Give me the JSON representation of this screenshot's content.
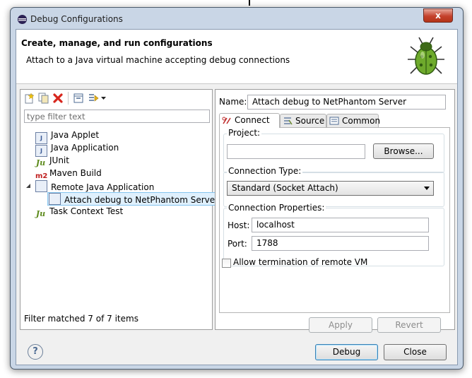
{
  "window": {
    "title": "Debug Configurations",
    "close_glyph": "x"
  },
  "banner": {
    "title": "Create, manage, and run configurations",
    "subtitle": "Attach to a Java virtual machine accepting debug connections",
    "icon": "bug-icon"
  },
  "left": {
    "toolbar": [
      "new-config-icon",
      "duplicate-icon",
      "delete-icon",
      "collapse-all-icon",
      "filter-icon",
      "dropdown-arrow-icon"
    ],
    "filter_placeholder": "type filter text",
    "tree": [
      {
        "label": "Java Applet",
        "icon": "java-applet-icon"
      },
      {
        "label": "Java Application",
        "icon": "java-app-icon"
      },
      {
        "label": "JUnit",
        "icon": "junit-icon"
      },
      {
        "label": "Maven Build",
        "icon": "maven-icon"
      },
      {
        "label": "Remote Java Application",
        "icon": "remote-java-icon"
      },
      {
        "label": "Attach debug to NetPhantom Server",
        "icon": "remote-java-icon"
      },
      {
        "label": "Task Context Test",
        "icon": "junit-icon"
      }
    ],
    "status": "Filter matched 7 of 7 items"
  },
  "right": {
    "name_label": "Name:",
    "name_value": "Attach debug to NetPhantom Server",
    "tabs": [
      {
        "label": "Connect",
        "icon": "connect-icon",
        "active": true
      },
      {
        "label": "Source",
        "icon": "source-icon",
        "active": false
      },
      {
        "label": "Common",
        "icon": "common-icon",
        "active": false
      }
    ],
    "project": {
      "group_label": "Project:",
      "value": "",
      "browse_label": "Browse..."
    },
    "connection_type": {
      "group_label": "Connection Type:",
      "selected": "Standard (Socket Attach)"
    },
    "connection_props": {
      "group_label": "Connection Properties:",
      "host_label": "Host:",
      "host_value": "localhost",
      "port_label": "Port:",
      "port_value": "1788"
    },
    "allow_termination": {
      "label": "Allow termination of remote VM",
      "checked": false
    },
    "apply_label": "Apply",
    "revert_label": "Revert"
  },
  "footer": {
    "help_glyph": "?",
    "debug_label": "Debug",
    "close_label": "Close"
  }
}
